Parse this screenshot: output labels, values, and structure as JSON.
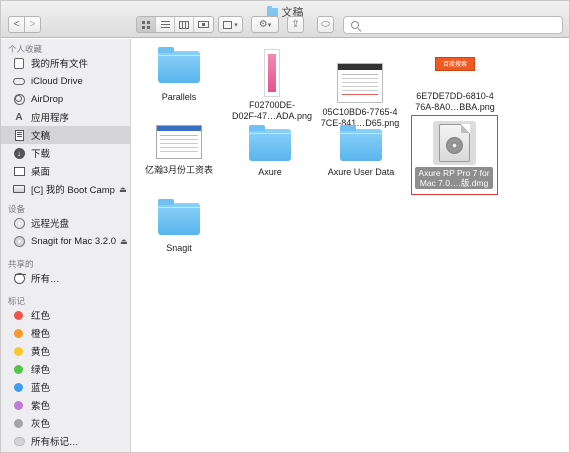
{
  "window": {
    "title": "文稿"
  },
  "toolbar": {
    "back_label": "<",
    "forward_label": ">",
    "view_buttons": [
      "icon-view",
      "list-view",
      "column-view",
      "cover-flow-view"
    ],
    "action_label": "⚙",
    "share_label": "⇪",
    "tag_label": "⬭"
  },
  "search": {
    "placeholder": "",
    "value": ""
  },
  "sidebar": {
    "sections": [
      {
        "title": "个人收藏",
        "items": [
          {
            "label": "我的所有文件",
            "icon": "all-files-icon"
          },
          {
            "label": "iCloud Drive",
            "icon": "cloud-icon"
          },
          {
            "label": "AirDrop",
            "icon": "airdrop-icon"
          },
          {
            "label": "应用程序",
            "icon": "applications-icon"
          },
          {
            "label": "文稿",
            "icon": "documents-icon",
            "selected": true
          },
          {
            "label": "下载",
            "icon": "downloads-icon"
          },
          {
            "label": "桌面",
            "icon": "desktop-icon"
          },
          {
            "label": "[C] 我的 Boot Camp",
            "icon": "hard-drive-icon",
            "eject": "⏏"
          }
        ]
      },
      {
        "title": "设备",
        "items": [
          {
            "label": "远程光盘",
            "icon": "remote-disc-icon"
          },
          {
            "label": "Snagit for Mac 3.2.0",
            "icon": "volume-icon",
            "eject": "⏏"
          }
        ]
      },
      {
        "title": "共享的",
        "items": [
          {
            "label": "所有…",
            "icon": "network-icon"
          }
        ]
      },
      {
        "title": "标记",
        "items": [
          {
            "label": "红色",
            "color": "#f0554b"
          },
          {
            "label": "橙色",
            "color": "#f59a2e"
          },
          {
            "label": "黄色",
            "color": "#f4c92e"
          },
          {
            "label": "绿色",
            "color": "#55c545"
          },
          {
            "label": "蓝色",
            "color": "#3d9ef1"
          },
          {
            "label": "紫色",
            "color": "#c07ad8"
          },
          {
            "label": "灰色",
            "color": "#a4a4a8"
          },
          {
            "label": "所有标记…",
            "icon": "all-tags-icon"
          }
        ]
      }
    ]
  },
  "files": [
    {
      "name": "Parallels",
      "kind": "folder"
    },
    {
      "name": "F02700DE-D02F-47…ADA.png",
      "line1": "F02700DE-",
      "line2": "D02F-47…ADA.png",
      "kind": "png"
    },
    {
      "name": "05C10BD6-7765-47CE-841…D65.png",
      "line1": "05C10BD6-7765-4",
      "line2": "7CE-841…D65.png",
      "kind": "png"
    },
    {
      "name": "6E7DE7DD-6810-476A-8A0…BBA.png",
      "line1": "6E7DE7DD-6810-4",
      "line2": "76A-8A0…BBA.png",
      "kind": "png",
      "thumb_text": "百度搜索"
    },
    {
      "name": "亿瀚3月份工资表",
      "kind": "png"
    },
    {
      "name": "Axure",
      "kind": "folder"
    },
    {
      "name": "Axure User Data",
      "kind": "folder"
    },
    {
      "name": "Axure RP Pro 7 for Mac 7.0….版.dmg",
      "line1": "Axure RP Pro 7 for",
      "line2": "Mac 7.0….版.dmg",
      "kind": "dmg",
      "selected": true
    },
    {
      "name": "Snagit",
      "kind": "folder"
    }
  ]
}
